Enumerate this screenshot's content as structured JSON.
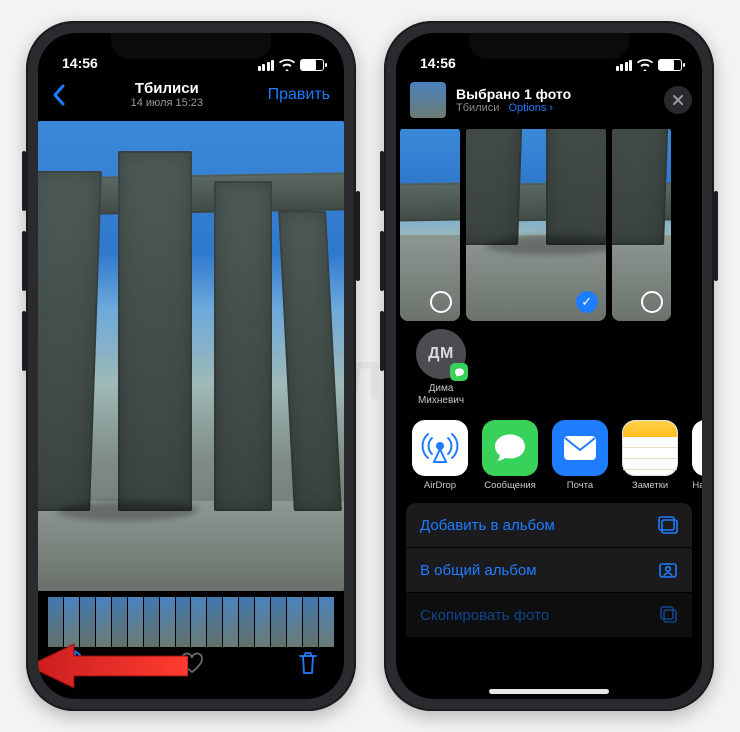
{
  "status": {
    "time": "14:56"
  },
  "left": {
    "nav": {
      "title": "Тбилиси",
      "subtitle": "14 июля  15:23",
      "edit": "Править"
    }
  },
  "right": {
    "header": {
      "title": "Выбрано 1 фото",
      "subtitle": "Тбилиси",
      "options": "Options"
    },
    "contact": {
      "initials": "ДМ",
      "name_line1": "Дима",
      "name_line2": "Михневич"
    },
    "apps": {
      "airdrop": "AirDrop",
      "messages": "Сообщения",
      "mail": "Почта",
      "notes": "Заметки",
      "peek": "Нап"
    },
    "actions": {
      "add_to_album": "Добавить в альбом",
      "shared_album": "В общий альбом",
      "copy_photo": "Скопировать фото"
    }
  },
  "watermark": "ЯБЛЫК"
}
